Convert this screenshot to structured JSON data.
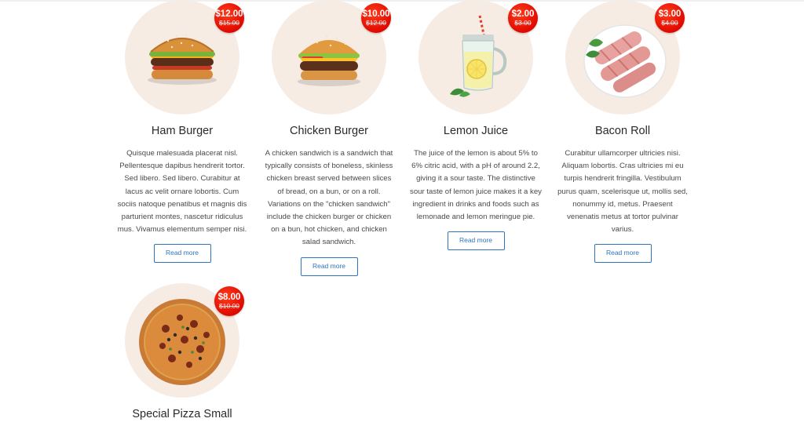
{
  "products": [
    {
      "name": "Ham Burger",
      "price": "$12.00",
      "old_price": "$15.00",
      "description": "Quisque malesuada placerat nisl. Pellentesque dapibus hendrerit tortor. Sed libero. Sed libero. Curabitur at lacus ac velit ornare lobortis. Cum sociis natoque penatibus et magnis dis parturient montes, nascetur ridiculus mus. Vivamus elementum semper nisi.",
      "button": "Read more",
      "icon": "burger-image"
    },
    {
      "name": "Chicken Burger",
      "price": "$10.00",
      "old_price": "$12.00",
      "description": "A chicken sandwich is a sandwich that typically consists of boneless, skinless chicken breast served between slices of bread, on a bun, or on a roll. Variations on the \"chicken sandwich\" include the chicken burger or chicken on a bun, hot chicken, and chicken salad sandwich.",
      "button": "Read more",
      "icon": "chicken-burger-image"
    },
    {
      "name": "Lemon Juice",
      "price": "$2.00",
      "old_price": "$3.00",
      "description": "The juice of the lemon is about 5% to 6% citric acid, with a pH of around 2.2, giving it a sour taste. The distinctive sour taste of lemon juice makes it a key ingredient in drinks and foods such as lemonade and lemon meringue pie.",
      "button": "Read more",
      "icon": "lemon-juice-image"
    },
    {
      "name": "Bacon Roll",
      "price": "$3.00",
      "old_price": "$4.00",
      "description": "Curabitur ullamcorper ultricies nisi. Aliquam lobortis. Cras ultricies mi eu turpis hendrerit fringilla. Vestibulum purus quam, scelerisque ut, mollis sed, nonummy id, metus. Praesent venenatis metus at tortor pulvinar varius.",
      "button": "Read more",
      "icon": "bacon-roll-image"
    },
    {
      "name": "Special Pizza Small",
      "price": "$8.00",
      "old_price": "$10.00",
      "icon": "pizza-image"
    }
  ],
  "colors": {
    "badge": "#e00a00",
    "thumb_bg": "#f6ece4",
    "button_border": "#2f74c0"
  }
}
